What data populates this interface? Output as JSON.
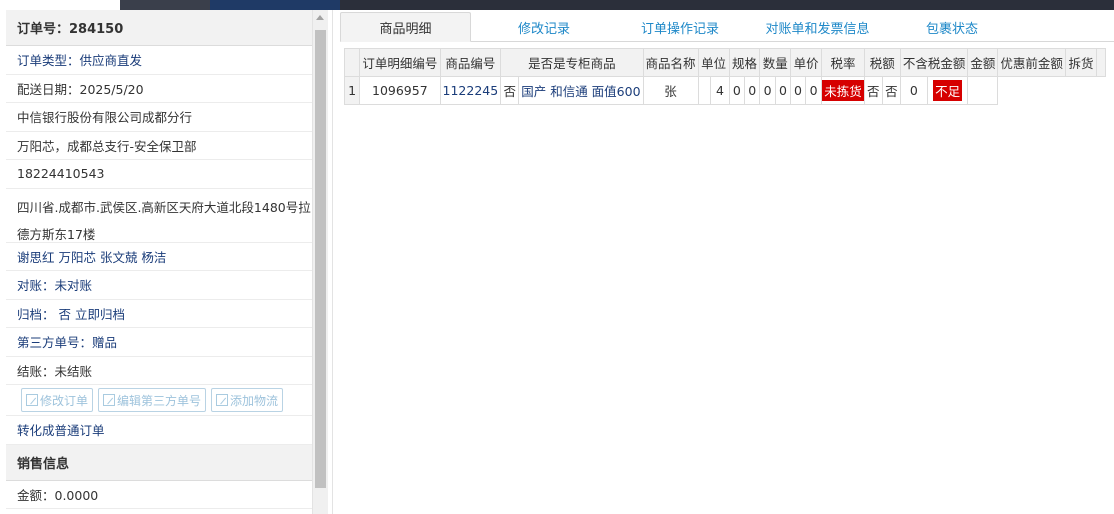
{
  "order": {
    "title": "订单号：284150"
  },
  "left_rows": [
    "订单类型：供应商直发",
    "配送日期：2025/5/20",
    "中信银行股份有限公司成都分行",
    "万阳芯，成都总支行-安全保卫部",
    "18224410543",
    "四川省.成都市.武侯区.高新区天府大道北段1480号拉德方斯东17楼",
    "谢思红 万阳芯 张文兢 杨洁",
    "对账：未对账",
    "归档： 否 立即归档",
    "第三方单号：赠品",
    "结账：未结账"
  ],
  "actions": {
    "edit_order": "修改订单",
    "edit_third_party": "编辑第三方单号",
    "add_logistics": "添加物流",
    "convert": "转化成普通订单"
  },
  "sales": {
    "title": "销售信息",
    "amount": "金额：0.0000"
  },
  "tabs": [
    "商品明细",
    "修改记录",
    "订单操作记录",
    "对账单和发票信息",
    "包裹状态"
  ],
  "table": {
    "headers": [
      "订单明细编号",
      "商品编号",
      "是否是专柜商品",
      "商品名称",
      "单位",
      "规格",
      "数量",
      "单价",
      "税率",
      "税额",
      "不含税金额",
      "金额",
      "优惠前金额",
      "拆货"
    ],
    "row": {
      "index": "1",
      "detail_id": "1096957",
      "product_id": "1122245",
      "is_counter": "否",
      "name": "国产 和信通 面值600",
      "unit": "张",
      "spec": "",
      "qty": "4",
      "c1": "0",
      "c2": "0",
      "c3": "0",
      "c4": "0",
      "c5": "0",
      "c6": "0",
      "c7": "0",
      "badge1": "未拣货",
      "f1": "否",
      "f2": "否",
      "f3": "0",
      "badge2": "不足"
    }
  },
  "colors": {
    "accent": "#1e88c8",
    "link": "#1b3d7a",
    "badge_red": "#d60000"
  }
}
